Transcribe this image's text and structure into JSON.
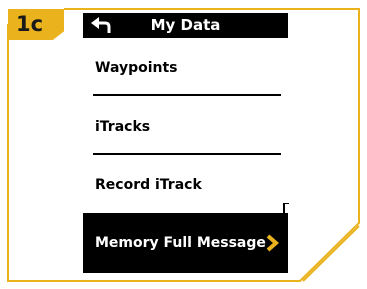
{
  "step": {
    "label": "1c"
  },
  "header": {
    "title": "My Data",
    "back_icon": "back-arrow-icon"
  },
  "menu": {
    "items": [
      {
        "label": "Waypoints"
      },
      {
        "label": "iTracks"
      },
      {
        "label": "Record iTrack"
      },
      {
        "label": "Memory Full Message",
        "selected": true,
        "icon": "chevron-right-icon"
      }
    ]
  },
  "colors": {
    "accent": "#eab21d",
    "screen_header": "#000000",
    "selection": "#000000",
    "chevron": "#eab21d"
  }
}
